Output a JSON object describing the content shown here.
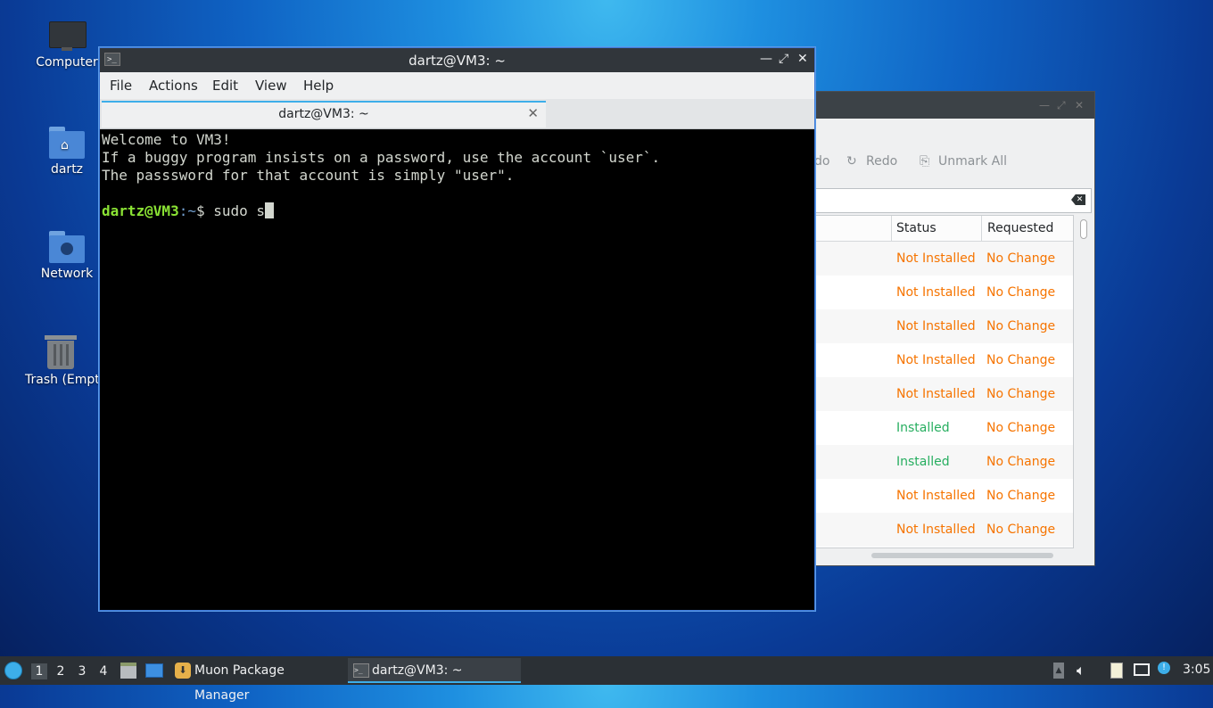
{
  "desktop": {
    "icons": [
      {
        "label": "Computer"
      },
      {
        "label": "dartz"
      },
      {
        "label": "Network"
      },
      {
        "label": "Trash (Empty)"
      }
    ]
  },
  "muon": {
    "toolbar": {
      "undo_partial": "do",
      "redo": "Redo",
      "unmark_all": "Unmark All"
    },
    "columns": {
      "status": "Status",
      "requested": "Requested"
    },
    "rows": [
      {
        "status": "Not Installed",
        "requested": "No Change"
      },
      {
        "status": "Not Installed",
        "requested": "No Change"
      },
      {
        "status": "Not Installed",
        "requested": "No Change"
      },
      {
        "status": "Not Installed",
        "requested": "No Change"
      },
      {
        "status": "Not Installed",
        "requested": "No Change"
      },
      {
        "status": "Installed",
        "requested": "No Change"
      },
      {
        "status": "Installed",
        "requested": "No Change"
      },
      {
        "status": "Not Installed",
        "requested": "No Change"
      },
      {
        "status": "Not Installed",
        "requested": "No Change"
      }
    ],
    "colors": {
      "not_installed": "#f67400",
      "installed": "#27ae60",
      "no_change": "#f67400"
    }
  },
  "terminal": {
    "title": "dartz@VM3: ~",
    "menu": {
      "file": "File",
      "actions": "Actions",
      "edit": "Edit",
      "view": "View",
      "help": "Help"
    },
    "tab_title": "dartz@VM3: ~",
    "lines": [
      "Welcome to VM3!",
      "If a buggy program insists on a password, use the account `user`.",
      "The passsword for that account is simply \"user\"."
    ],
    "prompt_user": "dartz@VM3",
    "prompt_path": ":~",
    "prompt_symbol": "$ ",
    "command": "sudo s"
  },
  "taskbar": {
    "workspaces": [
      "1",
      "2",
      "3",
      "4"
    ],
    "tasks": [
      {
        "label": "Muon Package Manager"
      },
      {
        "label": "dartz@VM3: ~"
      }
    ],
    "clock": "3:05"
  }
}
